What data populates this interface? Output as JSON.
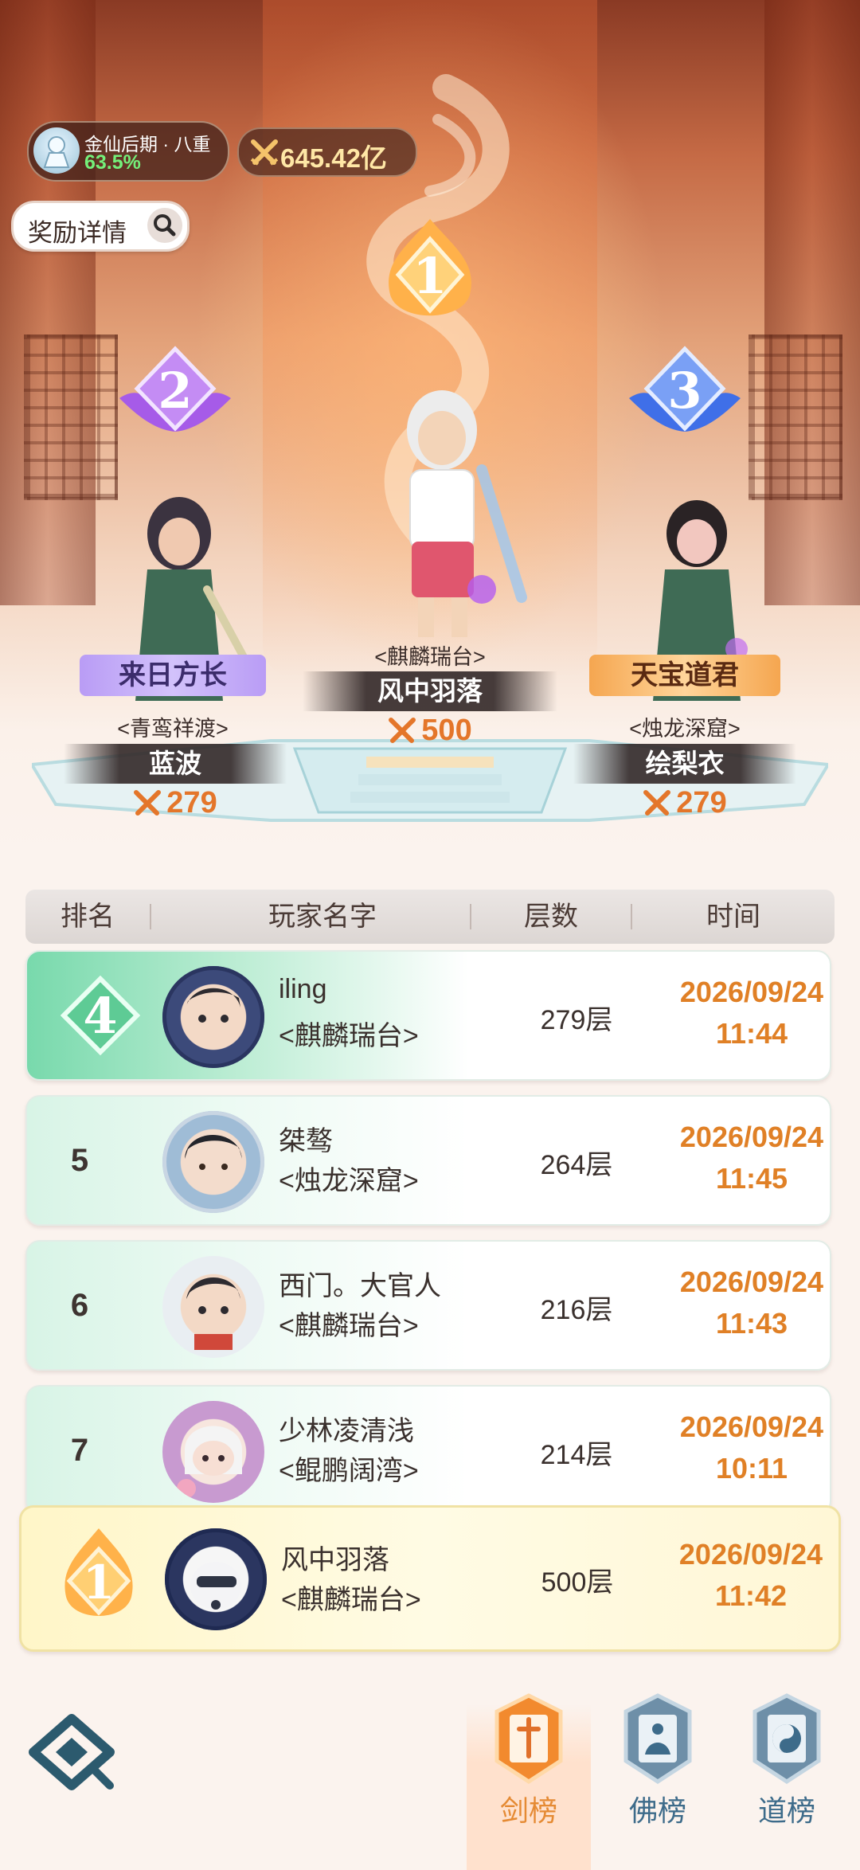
{
  "status": {
    "realm": "金仙后期 · 八重",
    "realm_progress": "63.5%",
    "power": "645.42亿"
  },
  "reward_button": {
    "label": "奖励详情"
  },
  "podium": [
    {
      "rank": "1",
      "guild": "<麒麟瑞台>",
      "name": "风中羽落",
      "power": "500"
    },
    {
      "rank": "2",
      "title": "来日方长",
      "guild": "<青鸾祥渡>",
      "name": "蓝波",
      "power": "279"
    },
    {
      "rank": "3",
      "title": "天宝道君",
      "guild": "<烛龙深窟>",
      "name": "绘梨衣",
      "power": "279"
    }
  ],
  "table": {
    "headers": [
      "排名",
      "玩家名字",
      "层数",
      "时间"
    ],
    "rows": [
      {
        "rank": "4",
        "name": "iling",
        "guild": "<麒麟瑞台>",
        "floors": "279层",
        "date": "2026/09/24",
        "time": "11:44"
      },
      {
        "rank": "5",
        "name": "桀骜",
        "guild": "<烛龙深窟>",
        "floors": "264层",
        "date": "2026/09/24",
        "time": "11:45"
      },
      {
        "rank": "6",
        "name": "西门。大官人",
        "guild": "<麒麟瑞台>",
        "floors": "216层",
        "date": "2026/09/24",
        "time": "11:43"
      },
      {
        "rank": "7",
        "name": "少林凌清浅",
        "guild": "<鲲鹏阔湾>",
        "floors": "214层",
        "date": "2026/09/24",
        "time": "10:11"
      }
    ],
    "me": {
      "rank": "1",
      "name": "风中羽落",
      "guild": "<麒麟瑞台>",
      "floors": "500层",
      "date": "2026/09/24",
      "time": "11:42"
    }
  },
  "tabs": [
    {
      "label": "剑榜",
      "icon": "sword-banner-icon",
      "active": true
    },
    {
      "label": "佛榜",
      "icon": "buddha-banner-icon",
      "active": false
    },
    {
      "label": "道榜",
      "icon": "taiji-banner-icon",
      "active": false
    }
  ],
  "colors": {
    "accent": "#e08026",
    "tab_inactive": "#3d6b8a",
    "progress_green": "#74f07a"
  }
}
